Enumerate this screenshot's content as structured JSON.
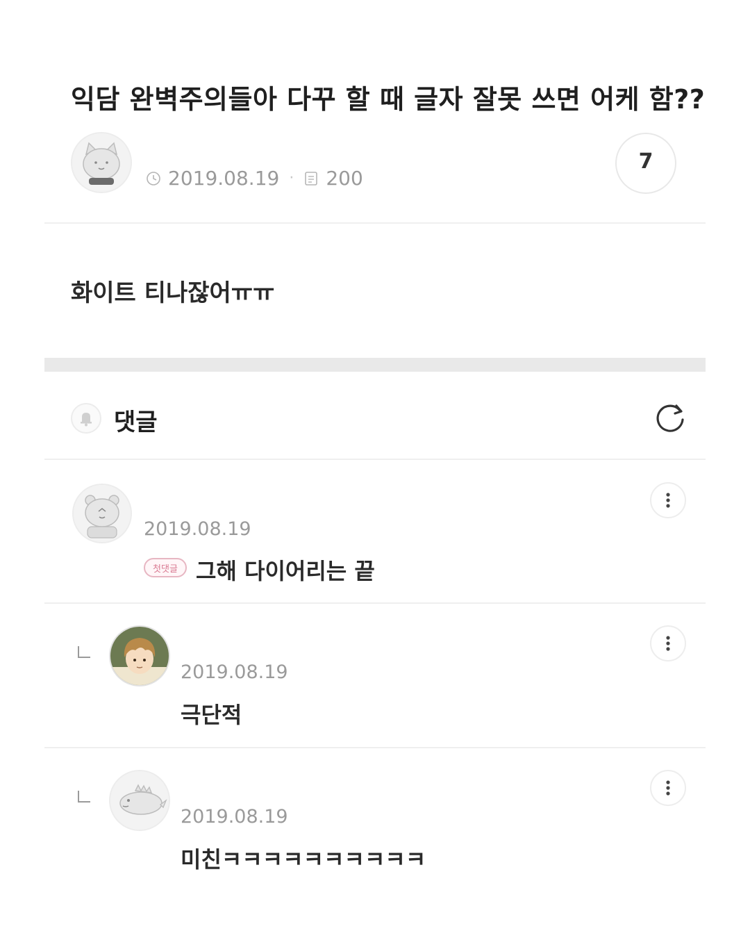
{
  "post": {
    "title": "익담 완벽주의들아 다꾸 할 때 글자 잘못 쓰면 어케 함??",
    "date": "2019.08.19",
    "views": "200",
    "comment_count": "7",
    "body": "화이트 티나잖어ㅠㅠ",
    "date_icon": "clock-icon",
    "views_icon": "document-icon"
  },
  "comments_section": {
    "label": "댓글",
    "header_icon": "bell-icon",
    "refresh_icon": "refresh-icon"
  },
  "comments": [
    {
      "date": "2019.08.19",
      "badge": "첫댓글",
      "text": "그해 다이어리는 끝",
      "is_reply": false,
      "avatar": "bear-avatar"
    },
    {
      "date": "2019.08.19",
      "text": "극단적",
      "is_reply": true,
      "avatar": "anime-boy-avatar"
    },
    {
      "date": "2019.08.19",
      "text": "미친ㅋㅋㅋㅋㅋㅋㅋㅋㅋㅋ",
      "is_reply": true,
      "avatar": "dinosaur-avatar"
    }
  ],
  "colors": {
    "accent_badge": "#d97a92",
    "muted_text": "#9a9a9a",
    "divider": "#e9e9e9"
  }
}
